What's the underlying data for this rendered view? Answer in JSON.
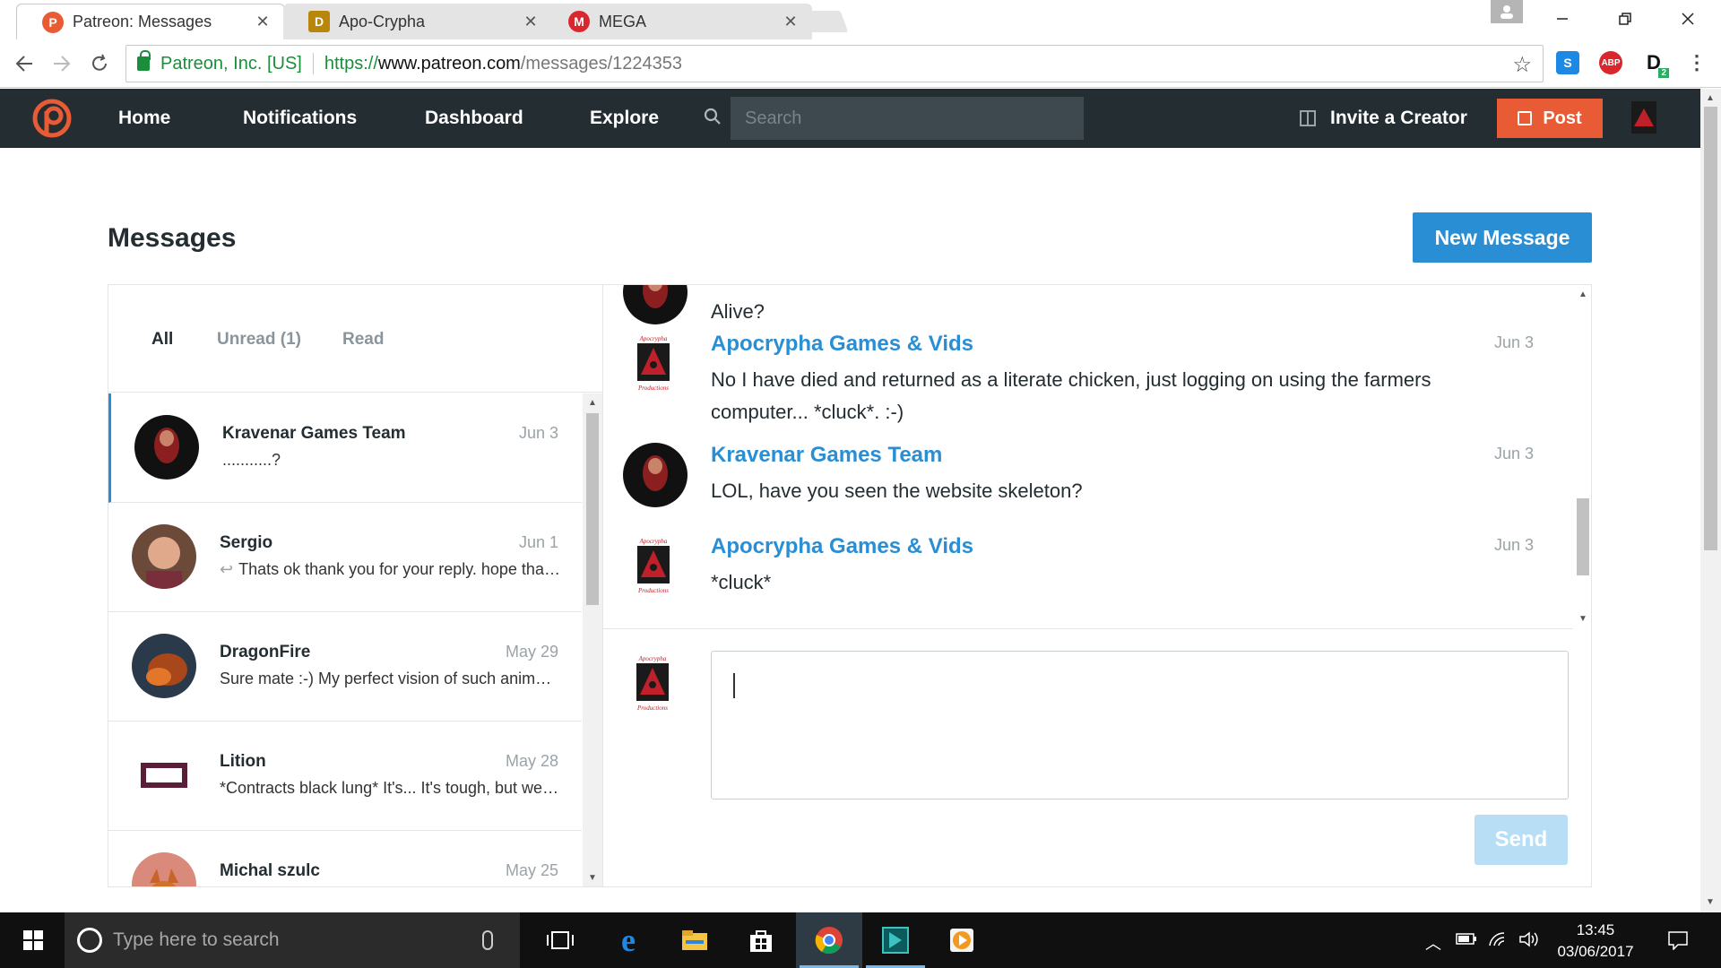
{
  "browser": {
    "tabs": [
      {
        "title": "Patreon: Messages",
        "favicon_color": "#e85b35",
        "active": true
      },
      {
        "title": "Apo-Crypha",
        "favicon_color": "#b8860b",
        "active": false
      },
      {
        "title": "MEGA",
        "favicon_color": "#d9272e",
        "active": false
      }
    ],
    "tab_close": "✕",
    "secure_label": "Patreon, Inc. [US]",
    "url_proto": "https://",
    "url_host": "www.patreon.com",
    "url_path": "/messages/1224353",
    "extension_badge": "2"
  },
  "nav": {
    "home": "Home",
    "notifications": "Notifications",
    "dashboard": "Dashboard",
    "explore": "Explore",
    "search_placeholder": "Search",
    "invite": "Invite a Creator",
    "post": "Post"
  },
  "page": {
    "title": "Messages",
    "new_message": "New Message"
  },
  "filters": {
    "all": "All",
    "unread": "Unread (1)",
    "read": "Read"
  },
  "conversations": [
    {
      "name": "Kravenar Games Team",
      "date": "Jun 3",
      "preview": "...........?"
    },
    {
      "name": "Sergio",
      "date": "Jun 1",
      "preview": "Thats ok thank you for your reply. hope that you will get some patrons..."
    },
    {
      "name": "DragonFire",
      "date": "May 29",
      "preview": "Sure mate :-) My perfect vision of such animations..."
    },
    {
      "name": "Lition",
      "date": "May 28",
      "preview": "*Contracts black lung* It's... It's tough, but we'll..."
    },
    {
      "name": "Michal szulc",
      "date": "May 25",
      "preview": ""
    }
  ],
  "thread": [
    {
      "sender": "",
      "date": "",
      "text": "Alive?"
    },
    {
      "sender": "Apocrypha Games & Vids",
      "date": "Jun 3",
      "text": "No I have died and returned as a literate chicken, just logging on using the farmers computer... *cluck*. :-)"
    },
    {
      "sender": "Kravenar Games Team",
      "date": "Jun 3",
      "text": "LOL, have you seen the website skeleton?"
    },
    {
      "sender": "Apocrypha Games & Vids",
      "date": "Jun 3",
      "text": "*cluck*"
    }
  ],
  "logo_text": {
    "top": "Apocrypha",
    "bottom": "Productions"
  },
  "composer": {
    "send": "Send",
    "value": ""
  },
  "taskbar": {
    "search_placeholder": "Type here to search",
    "time": "13:45",
    "date": "03/06/2017"
  }
}
